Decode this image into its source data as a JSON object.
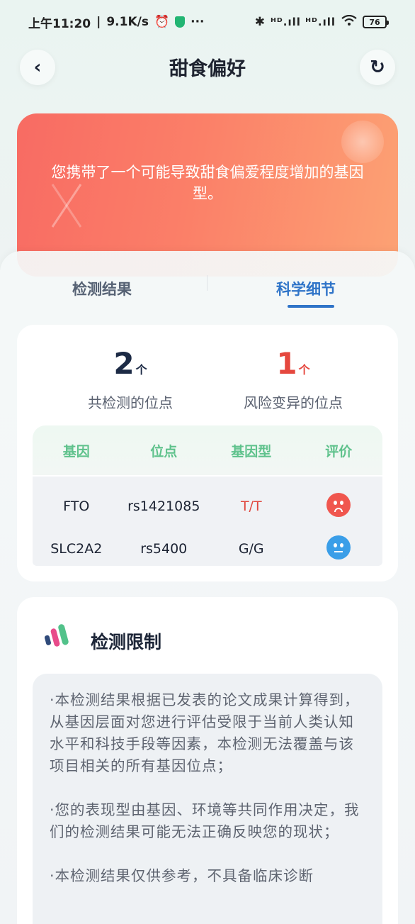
{
  "status_bar": {
    "time": "上午11:20",
    "speed": "9.1K/s",
    "more": "···",
    "signal": "ᴴᴰ.ıll ᴴᴰ.ıll",
    "battery": "76"
  },
  "header": {
    "title": "甜食偏好",
    "back_glyph": "‹",
    "refresh_glyph": "↻"
  },
  "banner": {
    "text": "您携带了一个可能导致甜食偏爱程度增加的基因型。"
  },
  "tabs": [
    {
      "label": "检测结果",
      "active": false
    },
    {
      "label": "科学细节",
      "active": true
    }
  ],
  "stats": {
    "total": {
      "value": "2",
      "unit": "个",
      "label": "共检测的位点"
    },
    "risk": {
      "value": "1",
      "unit": "个",
      "label": "风险变异的位点"
    }
  },
  "table": {
    "headers": [
      "基因",
      "位点",
      "基因型",
      "评价"
    ],
    "rows": [
      {
        "gene": "FTO",
        "site": "rs1421085",
        "genotype": "T/T",
        "evaluation": "sad-face-icon"
      },
      {
        "gene": "SLC2A2",
        "site": "rs5400",
        "genotype": "G/G",
        "evaluation": "neutral-face-icon"
      }
    ]
  },
  "limits": {
    "title": "检测限制",
    "paragraphs": [
      "·本检测结果根据已发表的论文成果计算得到，从基因层面对您进行评估受限于当前人类认知水平和科技手段等因素，本检测无法覆盖与该项目相关的所有基因位点；",
      "·您的表现型由基因、环境等共同作用决定，我们的检测结果可能无法正确反映您的现状；",
      "·本检测结果仅供参考，不具备临床诊断"
    ]
  },
  "colors": {
    "accent_blue": "#2f74c8",
    "risk_red": "#e5473e",
    "table_header_green": "#5fc28c",
    "banner_start": "#f86b63",
    "banner_end": "#fca274"
  }
}
